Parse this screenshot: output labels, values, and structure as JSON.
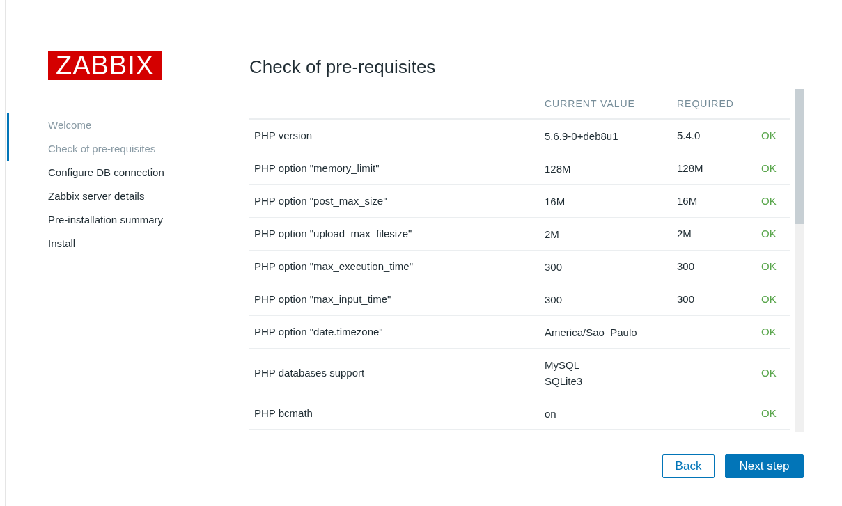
{
  "logo": "ZABBIX",
  "steps": [
    {
      "label": "Welcome",
      "completed": true
    },
    {
      "label": "Check of pre-requisites",
      "completed": true
    },
    {
      "label": "Configure DB connection",
      "completed": false
    },
    {
      "label": "Zabbix server details",
      "completed": false
    },
    {
      "label": "Pre-installation summary",
      "completed": false
    },
    {
      "label": "Install",
      "completed": false
    }
  ],
  "title": "Check of pre-requisites",
  "table": {
    "columns": [
      "CURRENT VALUE",
      "REQUIRED"
    ],
    "rows": [
      {
        "name": "PHP version",
        "current": [
          "5.6.9-0+deb8u1"
        ],
        "required": "5.4.0",
        "status": "OK",
        "passed": true
      },
      {
        "name": "PHP option \"memory_limit\"",
        "current": [
          "128M"
        ],
        "required": "128M",
        "status": "OK",
        "passed": true
      },
      {
        "name": "PHP option \"post_max_size\"",
        "current": [
          "16M"
        ],
        "required": "16M",
        "status": "OK",
        "passed": true
      },
      {
        "name": "PHP option \"upload_max_filesize\"",
        "current": [
          "2M"
        ],
        "required": "2M",
        "status": "OK",
        "passed": true
      },
      {
        "name": "PHP option \"max_execution_time\"",
        "current": [
          "300"
        ],
        "required": "300",
        "status": "OK",
        "passed": true
      },
      {
        "name": "PHP option \"max_input_time\"",
        "current": [
          "300"
        ],
        "required": "300",
        "status": "OK",
        "passed": true
      },
      {
        "name": "PHP option \"date.timezone\"",
        "current": [
          "America/Sao_Paulo"
        ],
        "status": "OK",
        "passed": true
      },
      {
        "name": "PHP databases support",
        "current": [
          "MySQL",
          "SQLite3"
        ],
        "status": "OK",
        "passed": true
      },
      {
        "name": "PHP bcmath",
        "current": [
          "on"
        ],
        "status": "OK",
        "passed": true
      }
    ]
  },
  "buttons": [
    {
      "label": "Back",
      "kind": "secondary"
    },
    {
      "label": "Next step",
      "kind": "primary"
    }
  ]
}
